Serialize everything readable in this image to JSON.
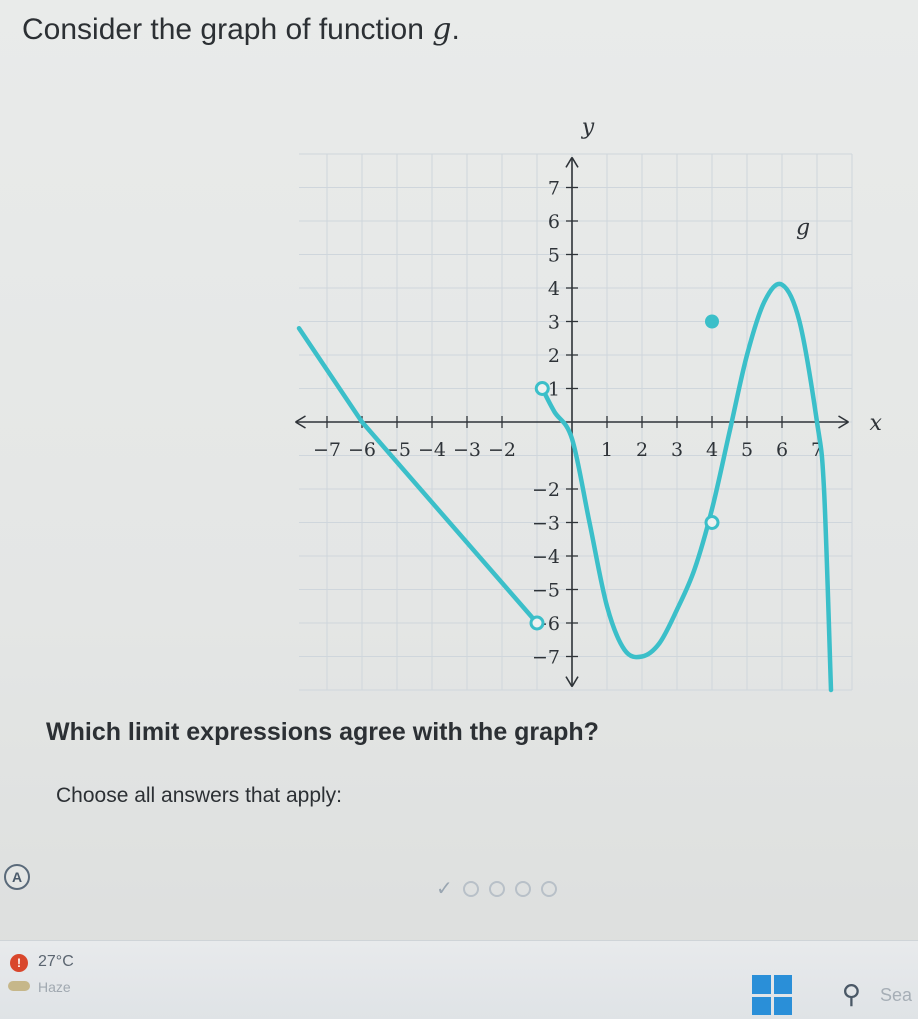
{
  "question": {
    "title_prefix": "Consider the graph of function ",
    "function_name": "g",
    "title_suffix": "."
  },
  "prompt": "Which limit expressions agree with the graph?",
  "instruction": "Choose all answers that apply:",
  "choices": [
    {
      "label": "A"
    }
  ],
  "taskbar": {
    "weather_temp": "27°C",
    "weather_desc": "Haze",
    "search_text": "Sea"
  },
  "chart_data": {
    "type": "line",
    "xlabel": "x",
    "ylabel": "y",
    "xlim": [
      -8,
      8
    ],
    "ylim": [
      -8,
      8
    ],
    "x_ticks": [
      -7,
      -6,
      -5,
      -4,
      -3,
      -2,
      1,
      2,
      3,
      4,
      5,
      6,
      7
    ],
    "x_tick_labels": [
      "−7",
      "−6",
      "−5",
      "−4",
      "−3",
      "−2",
      "1",
      "2",
      "3",
      "4",
      "5",
      "6",
      "7"
    ],
    "y_ticks": [
      7,
      6,
      5,
      4,
      3,
      2,
      1,
      -2,
      -3,
      -4,
      -5,
      -6,
      -7
    ],
    "y_tick_labels": [
      "7",
      "6",
      "5",
      "4",
      "3",
      "2",
      "1",
      "−2",
      "−3",
      "−4",
      "−5",
      "−6",
      "−7"
    ],
    "grid": true,
    "function_label": "g",
    "color": "#3bbfc9",
    "series": [
      {
        "points": [
          [
            -7.8,
            2.8
          ],
          [
            -6.0,
            0
          ],
          [
            -1,
            -6
          ]
        ]
      },
      {
        "points": [
          [
            -0.85,
            1
          ],
          [
            -0.5,
            0.3
          ],
          [
            0,
            -0.5
          ],
          [
            0.5,
            -3
          ],
          [
            1,
            -5.5
          ],
          [
            1.5,
            -6.8
          ],
          [
            2,
            -7
          ],
          [
            2.5,
            -6.6
          ],
          [
            3,
            -5.6
          ],
          [
            3.5,
            -4.4
          ],
          [
            4,
            -2.6
          ],
          [
            4.5,
            -0.3
          ],
          [
            5,
            2
          ],
          [
            5.5,
            3.6
          ],
          [
            6,
            4.1
          ],
          [
            6.5,
            3
          ],
          [
            7,
            0
          ],
          [
            7.2,
            -2
          ],
          [
            7.4,
            -8
          ]
        ]
      }
    ],
    "open_points": [
      [
        -1,
        -6
      ],
      [
        -0.85,
        1
      ],
      [
        4,
        -3
      ]
    ],
    "closed_points": [
      [
        4,
        3
      ]
    ]
  }
}
